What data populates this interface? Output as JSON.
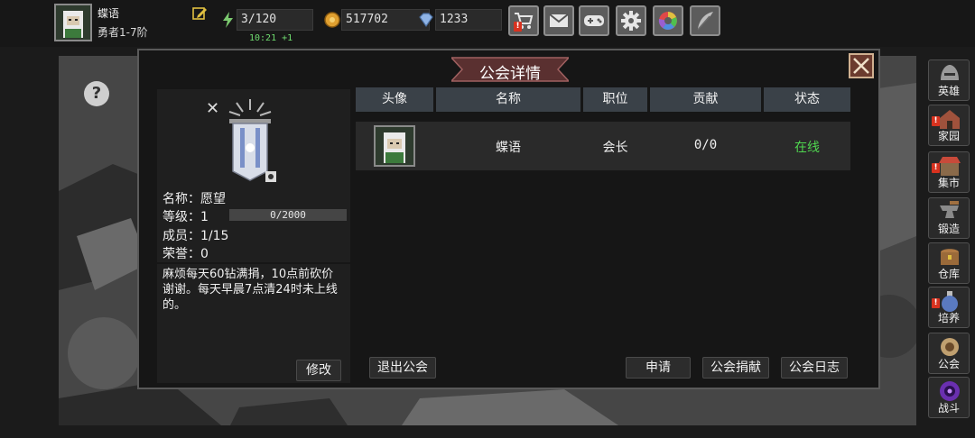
{
  "player": {
    "name": "蝶语",
    "rank": "勇者1-7阶"
  },
  "resources": {
    "stamina": "3/120",
    "gold": "517702",
    "gems": "1233",
    "timer": "10:21 +1"
  },
  "top_buttons": [
    "shop",
    "mail",
    "gamepad",
    "settings",
    "color-wheel",
    "feather"
  ],
  "dialog": {
    "title": "公会详情",
    "guild": {
      "name_label": "名称：",
      "name": "愿望",
      "level_label": "等级：",
      "level": "1",
      "exp": "0/2000",
      "exp_fraction": 0,
      "members_label": "成员：",
      "members": "1/15",
      "honor_label": "荣誉：",
      "honor": "0",
      "description": "麻烦每天60钻满捐，10点前砍价谢谢。每天早晨7点清24时未上线的。"
    },
    "buttons": {
      "modify": "修改",
      "leave": "退出公会",
      "apply": "申请",
      "donate": "公会捐献",
      "log": "公会日志"
    },
    "table": {
      "headers": [
        "头像",
        "名称",
        "职位",
        "贡献",
        "状态"
      ],
      "rows": [
        {
          "name": "蝶语",
          "role": "会长",
          "contribution": "0/0",
          "status": "在线"
        }
      ]
    }
  },
  "sidebar": [
    {
      "label": "英雄",
      "alert": false
    },
    {
      "label": "家园",
      "alert": true
    },
    {
      "label": "集市",
      "alert": true
    },
    {
      "label": "锻造",
      "alert": false
    },
    {
      "label": "仓库",
      "alert": false
    },
    {
      "label": "培养",
      "alert": true
    },
    {
      "label": "公会",
      "alert": false
    },
    {
      "label": "战斗",
      "alert": false
    }
  ],
  "colors": {
    "online": "#4fd64f",
    "alert": "#d8321f",
    "table_header": "#3a4148"
  }
}
